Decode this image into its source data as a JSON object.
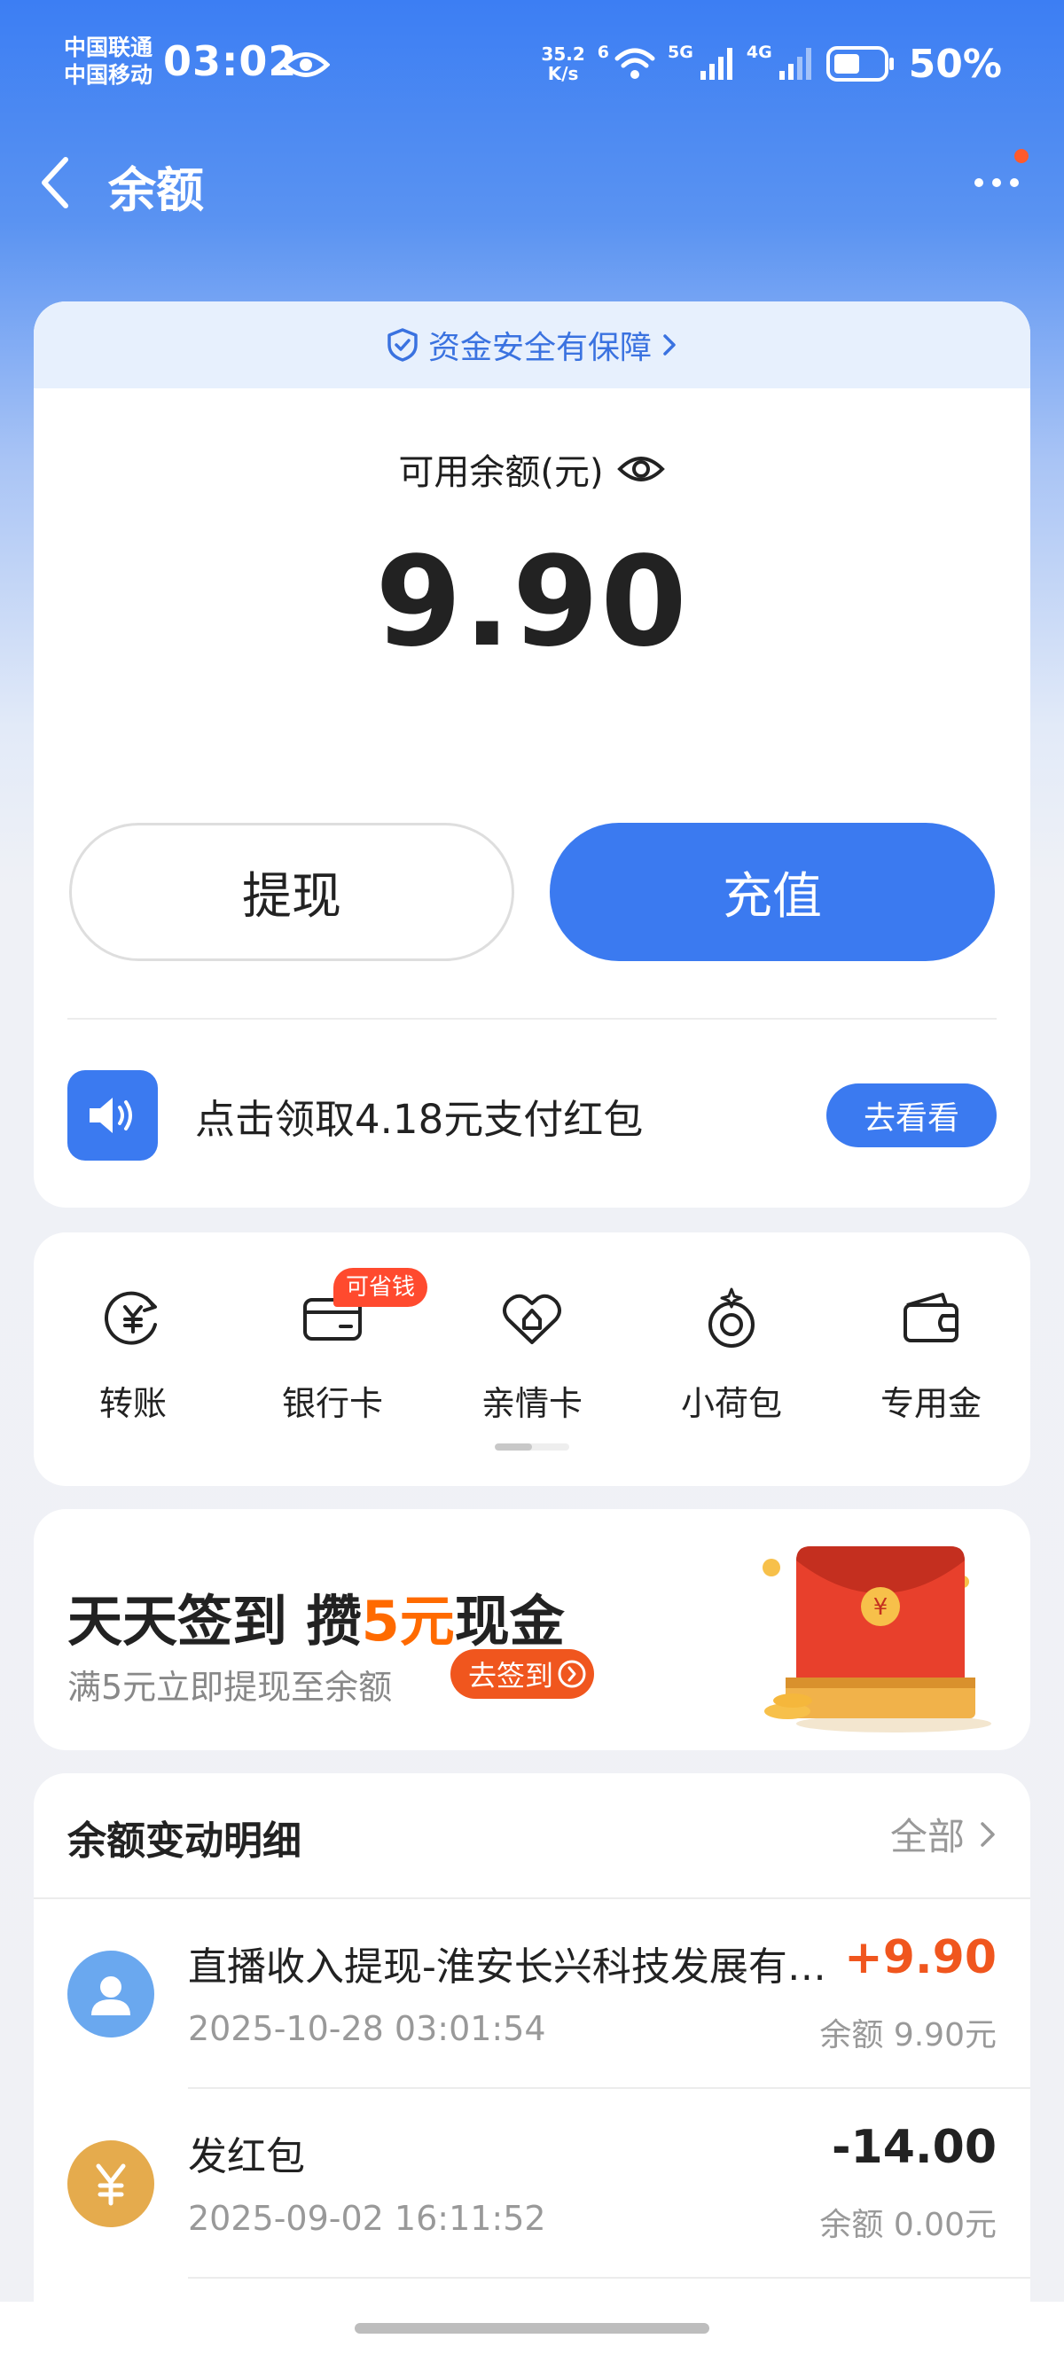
{
  "status_bar": {
    "carrier1": "中国联通",
    "carrier2": "中国移动",
    "time": "03:02",
    "speed_value": "35.2",
    "speed_unit": "K/s",
    "wifi_badge": "6",
    "net1": "5G",
    "net2": "4G",
    "battery": "50%"
  },
  "header": {
    "title": "余额"
  },
  "balance": {
    "safety_text": "资金安全有保障",
    "available_label": "可用余额(元)",
    "amount": "9.90",
    "withdraw_label": "提现",
    "recharge_label": "充值",
    "promo_text": "点击领取4.18元支付红包",
    "promo_button": "去看看"
  },
  "functions": {
    "items": [
      {
        "label": "转账",
        "icon": "transfer-icon"
      },
      {
        "label": "银行卡",
        "icon": "bank-card-icon"
      },
      {
        "label": "亲情卡",
        "icon": "family-card-icon"
      },
      {
        "label": "小荷包",
        "icon": "purse-icon"
      },
      {
        "label": "专用金",
        "icon": "wallet-icon"
      }
    ],
    "badge": "可省钱"
  },
  "checkin": {
    "title_a": "天天签到 攒",
    "title_b": "5元",
    "title_c": "现金",
    "subtitle": "满5元立即提现至余额",
    "button": "去签到"
  },
  "history": {
    "title": "余额变动明细",
    "all_label": "全部",
    "rows": [
      {
        "title": "直播收入提现-淮安长兴科技发展有限公司",
        "time": "2025-10-28 03:01:54",
        "amount": "+9.90",
        "balance": "余额 9.90元"
      },
      {
        "title": "发红包",
        "time": "2025-09-02 16:11:52",
        "amount": "-14.00",
        "balance": "余额 0.00元"
      }
    ]
  },
  "colors": {
    "accent": "#3b7af0",
    "income": "#f0561e",
    "expense": "#222222"
  }
}
